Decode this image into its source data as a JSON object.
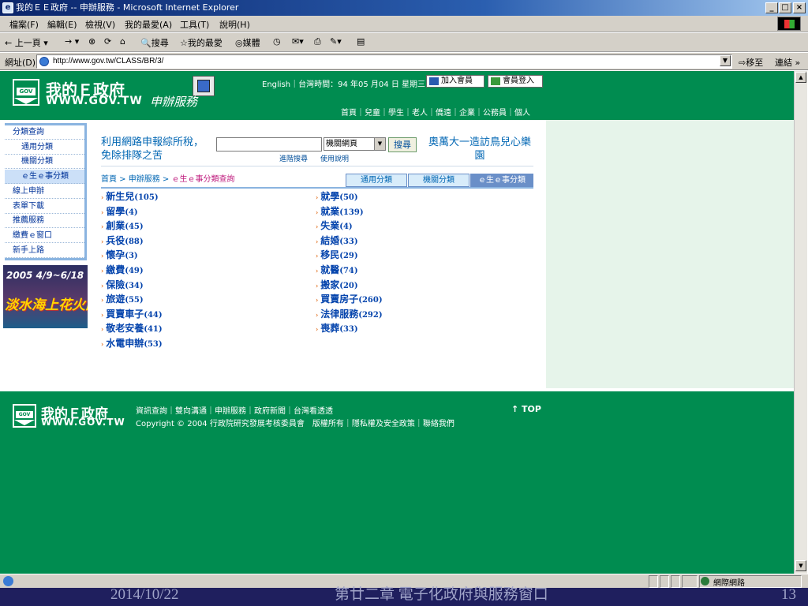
{
  "window": {
    "title": "我的ＥＥ政府 -- 申辦服務 - Microsoft Internet Explorer"
  },
  "menu": [
    "檔案(F)",
    "編輯(E)",
    "檢視(V)",
    "我的最愛(A)",
    "工具(T)",
    "說明(H)"
  ],
  "toolbar": {
    "back": "← 上一頁 ▾",
    "forward": "→ ▾",
    "search": "搜尋",
    "favorites": "我的最愛",
    "media": "媒體"
  },
  "address": {
    "label": "網址(D)",
    "url": "http://www.gov.tw/CLASS/BR/3/",
    "go": "移至",
    "links": "連結 »"
  },
  "header": {
    "site_name": "我的Ｅ政府",
    "site_url": "WWW.GOV.TW",
    "service": "申辦服務",
    "top_links": "English｜台灣時間：94 年05 月04 日 星期三",
    "join_button": "加入會員",
    "login_button": "會員登入",
    "nav": "首頁｜兒童｜學生｜老人｜僑遠｜企業｜公務員｜個人"
  },
  "sidebar": {
    "items": [
      {
        "label": "分類查詢",
        "sub": false,
        "active": false
      },
      {
        "label": "通用分類",
        "sub": true,
        "active": false
      },
      {
        "label": "機關分類",
        "sub": true,
        "active": false
      },
      {
        "label": "ｅ生ｅ事分類",
        "sub": true,
        "active": true
      },
      {
        "label": "線上申辦",
        "sub": false,
        "active": false
      },
      {
        "label": "表單下載",
        "sub": false,
        "active": false
      },
      {
        "label": "推薦服務",
        "sub": false,
        "active": false
      },
      {
        "label": "繳費ｅ窗口",
        "sub": false,
        "active": false
      },
      {
        "label": "新手上路",
        "sub": false,
        "active": false
      }
    ],
    "banner_date": "2005 4/9~6/18",
    "banner_title": "淡水海上花火節"
  },
  "main": {
    "promo_left": "利用網路申報綜所稅，免除排隊之苦",
    "search_value": "",
    "select_value": "機關網頁",
    "search_button": "搜尋",
    "advanced_search": "進階搜尋",
    "usage_help": "使用說明",
    "promo_right": "奧萬大一造訪鳥兒心樂園",
    "breadcrumb_home": "首頁",
    "breadcrumb_mid": "申辦服務",
    "breadcrumb_cur": "ｅ生ｅ事分類查詢",
    "tabs": [
      "通用分類",
      "機關分類",
      "ｅ生ｅ事分類"
    ],
    "left_categories": [
      {
        "name": "新生兒",
        "count": "(105)"
      },
      {
        "name": "留學",
        "count": "(4)"
      },
      {
        "name": "創業",
        "count": "(45)"
      },
      {
        "name": "兵役",
        "count": "(88)"
      },
      {
        "name": "懷孕",
        "count": "(3)"
      },
      {
        "name": "繳費",
        "count": "(49)"
      },
      {
        "name": "保險",
        "count": "(34)"
      },
      {
        "name": "旅遊",
        "count": "(55)"
      },
      {
        "name": "買賣車子",
        "count": "(44)"
      },
      {
        "name": "敬老安養",
        "count": "(41)"
      },
      {
        "name": "水電申辦",
        "count": "(53)"
      }
    ],
    "right_categories": [
      {
        "name": "就學",
        "count": "(50)"
      },
      {
        "name": "就業",
        "count": "(139)"
      },
      {
        "name": "失業",
        "count": "(4)"
      },
      {
        "name": "結婚",
        "count": "(33)"
      },
      {
        "name": "移民",
        "count": "(29)"
      },
      {
        "name": "就醫",
        "count": "(74)"
      },
      {
        "name": "搬家",
        "count": "(20)"
      },
      {
        "name": "買賣房子",
        "count": "(260)"
      },
      {
        "name": "法律服務",
        "count": "(292)"
      },
      {
        "name": "喪葬",
        "count": "(33)"
      }
    ]
  },
  "footer": {
    "site_name": "我的Ｅ政府",
    "site_url": "WWW.GOV.TW",
    "links": "資訊查詢｜雙向溝通｜申辦服務｜政府新聞｜台灣看透透",
    "copyright": "Copyright © 2004 行政院研究發展考核委員會　版權所有｜隱私權及安全政策｜聯絡我們",
    "top": "↑ TOP"
  },
  "statusbar": {
    "zone": "網際網路"
  },
  "slide": {
    "date": "2014/10/22",
    "caption": "第廿二章 電子化政府與服務窗口",
    "page": "13"
  },
  "colors": {
    "brand_green": "#008c50",
    "link_blue": "#0645ad",
    "slide_bg": "#1f1f5e"
  }
}
